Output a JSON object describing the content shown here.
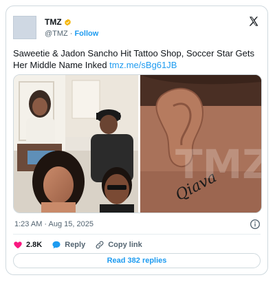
{
  "account": {
    "display_name": "TMZ",
    "handle": "@TMZ",
    "separator": "·",
    "follow_label": "Follow"
  },
  "tweet": {
    "text": "Saweetie & Jadon Sancho Hit Tattoo Shop, Soccer Star Gets Her Middle Name Inked ",
    "link_text": "tmz.me/sBg61JB",
    "timestamp": "1:23 AM · Aug 15, 2025"
  },
  "media": {
    "left_image_alt": "Saweetie and Jadon Sancho at tattoo shop collage",
    "right_image_alt": "Neck tattoo behind ear",
    "tattoo_text": "Qiava",
    "watermark": "TMZ"
  },
  "actions": {
    "like_count": "2.8K",
    "reply_label": "Reply",
    "copy_label": "Copy link"
  },
  "replies_button": "Read 382 replies",
  "colors": {
    "accent": "#1d9bf0",
    "like": "#f91880",
    "verified": "#f4b400"
  },
  "icons": [
    "verified-badge-icon",
    "x-logo-icon",
    "info-icon",
    "heart-icon",
    "reply-bubble-icon",
    "link-icon"
  ]
}
